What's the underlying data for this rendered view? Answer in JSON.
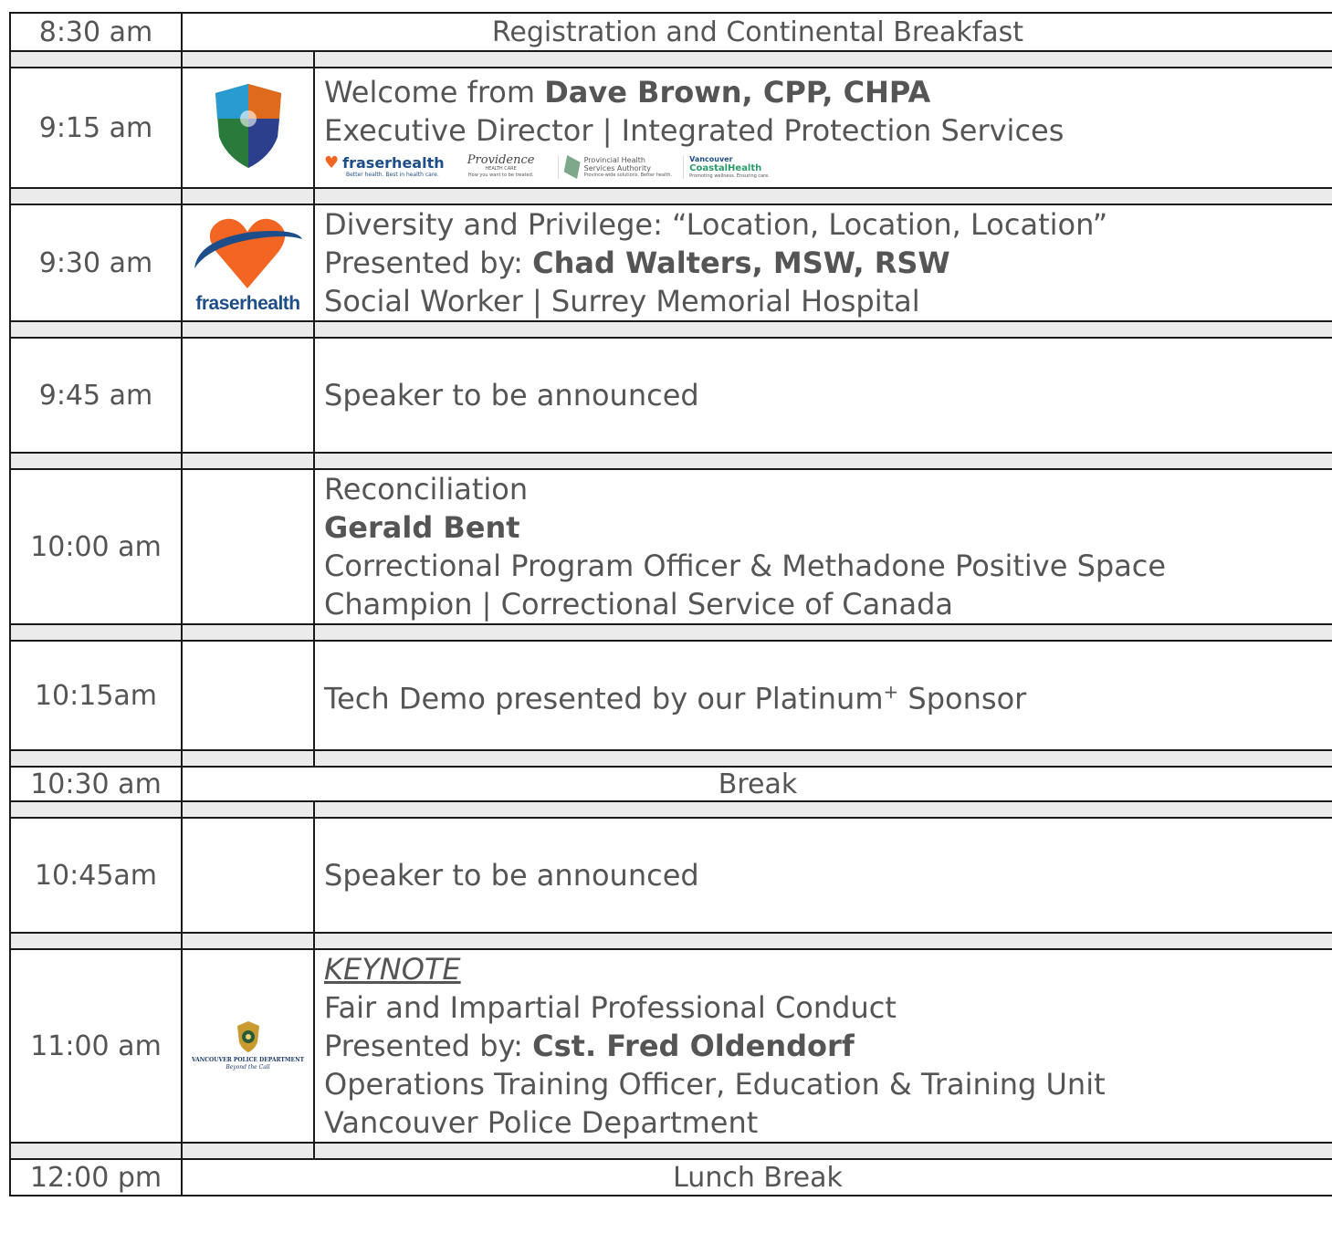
{
  "rows": {
    "r1": {
      "time": "8:30 am",
      "title": "Registration and Continental Breakfast"
    },
    "r2": {
      "time": "9:15 am",
      "welcome_prefix": "Welcome from ",
      "welcome_name": "Dave Brown, CPP, CHPA",
      "subtitle": "Executive Director | Integrated Protection Services",
      "sponsors": {
        "fraser": "fraserhealth",
        "fraser_tag": "Better health. Best in health care.",
        "providence": "Providence",
        "providence_sub": "HEALTH CARE",
        "providence_tag": "How you want to be treated.",
        "phsa_1": "Provincial Health",
        "phsa_2": "Services Authority",
        "phsa_tag": "Province-wide solutions. Better health.",
        "vch_1": "Vancouver",
        "vch_2": "CoastalHealth",
        "vch_tag": "Promoting wellness. Ensuring care."
      }
    },
    "r3": {
      "time": "9:30 am",
      "logo_text": "fraserhealth",
      "line1": "Diversity and Privilege: “Location, Location, Location”",
      "presented_prefix": "Presented by: ",
      "presenter": "Chad Walters, MSW, RSW",
      "line3": "Social Worker | Surrey Memorial Hospital"
    },
    "r4": {
      "time": "9:45 am",
      "line1": "Speaker to be announced"
    },
    "r5": {
      "time": "10:00 am",
      "line1": "Reconciliation",
      "presenter": "Gerald Bent",
      "line3": "Correctional Program Officer & Methadone Positive Space",
      "line4": "Champion | Correctional Service of Canada"
    },
    "r6": {
      "time": "10:15am",
      "line1": "Tech Demo presented by our Platinum",
      "sup": "+",
      "line1_end": " Sponsor"
    },
    "r7": {
      "time": "10:30 am",
      "title": "Break"
    },
    "r8": {
      "time": "10:45am",
      "line1": "Speaker to be announced"
    },
    "r9": {
      "time": "11:00 am",
      "keynote": "KEYNOTE",
      "line2": "Fair and Impartial Professional Conduct",
      "presented_prefix": "Presented by: ",
      "presenter": "Cst. Fred Oldendorf",
      "line4": "Operations Training Officer, Education & Training Unit",
      "line5": "Vancouver Police Department",
      "logo_text": "VANCOUVER POLICE DEPARTMENT",
      "logo_tag": "Beyond the Call"
    },
    "r10": {
      "time": "12:00 pm",
      "title": "Lunch Break"
    }
  },
  "colors": {
    "text": "#555555",
    "border": "#1a1a1a",
    "separator": "#ebebeb",
    "fraser_orange": "#f26522",
    "fraser_blue": "#1d4e89"
  }
}
